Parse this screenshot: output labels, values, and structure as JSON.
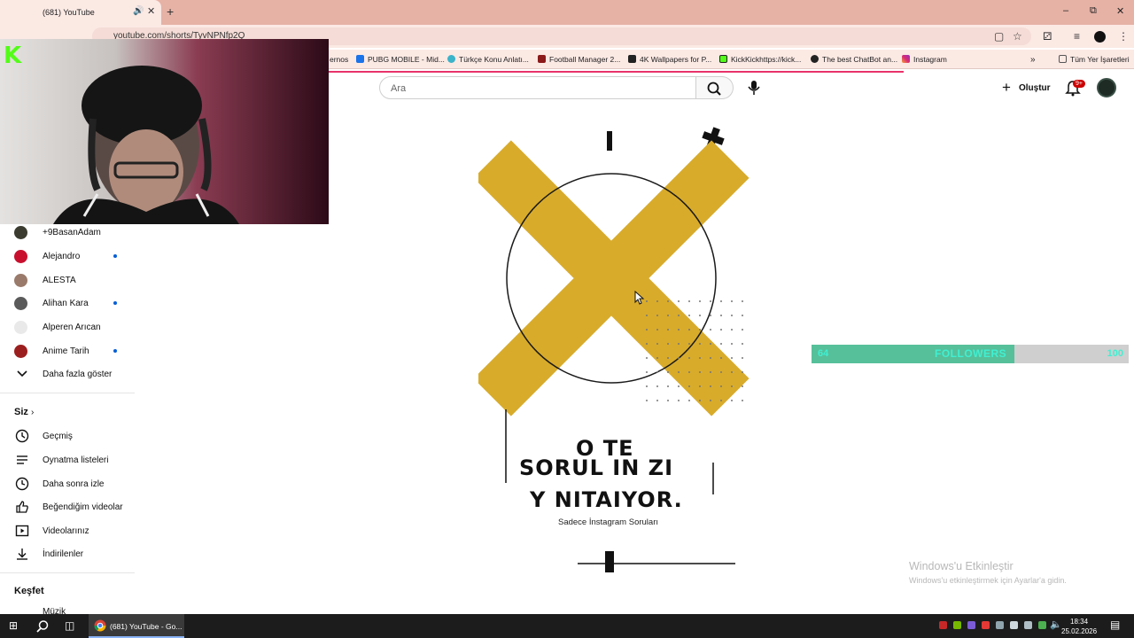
{
  "browser": {
    "tab_title": "(681) YouTube",
    "url": "youtube.com/shorts/TyvNPNfp2Q",
    "bookmarks": [
      "ernos",
      "PUBG MOBILE - Mid...",
      "Türkçe Konu Anlatı...",
      "Football Manager 2...",
      "4K Wallpapers for P...",
      "KickKickhttps://kick...",
      "The best ChatBot an...",
      "Instagram"
    ],
    "all_bookmarks": "Tüm Yer İşaretleri"
  },
  "youtube": {
    "search_placeholder": "Ara",
    "create_label": "Oluştur",
    "notif_count": "9+"
  },
  "overlay": {
    "kick_logo": "K"
  },
  "sidebar": {
    "subscriptions": [
      {
        "name": "+9BasanAdam",
        "new": false,
        "color": "#3b3b2f"
      },
      {
        "name": "Alejandro",
        "new": true,
        "color": "#c8102e"
      },
      {
        "name": "ALESTA",
        "new": false,
        "color": "#9a7a6a"
      },
      {
        "name": "Alihan Kara",
        "new": true,
        "color": "#5a5a5a"
      },
      {
        "name": "Alperen Arıcan",
        "new": false,
        "color": "#e9e9e9"
      },
      {
        "name": "Anime Tarih",
        "new": true,
        "color": "#9c1f1f"
      }
    ],
    "show_more": "Daha fazla göster",
    "you_section": "Siz",
    "you_items": [
      "Geçmiş",
      "Oynatma listeleri",
      "Daha sonra izle",
      "Beğendiğim videolar",
      "Videolarınız",
      "İndirilenler"
    ],
    "explore_section": "Keşfet",
    "explore_items": [
      "Müzik"
    ]
  },
  "short": {
    "line1": "O  TE",
    "line2": "SORUL  IN ZI",
    "line3": "Y NITAIYOR.",
    "caption": "Sadece İnstagram Soruları"
  },
  "followers": {
    "current": "64",
    "label": "FOLLOWERS",
    "goal": "100",
    "progress": 0.64
  },
  "windows": {
    "activate_title": "Windows'u Etkinleştir",
    "activate_sub": "Windows'u etkinleştirmek için Ayarlar'a gidin.",
    "taskbar_chrome": "(681) YouTube - Go...",
    "time": "18:34",
    "date": "25.02.2026"
  },
  "colors": {
    "accent_gold": "#d8ab2b",
    "followers_fill": "#56c09a",
    "followers_text": "#3ff0d2"
  }
}
